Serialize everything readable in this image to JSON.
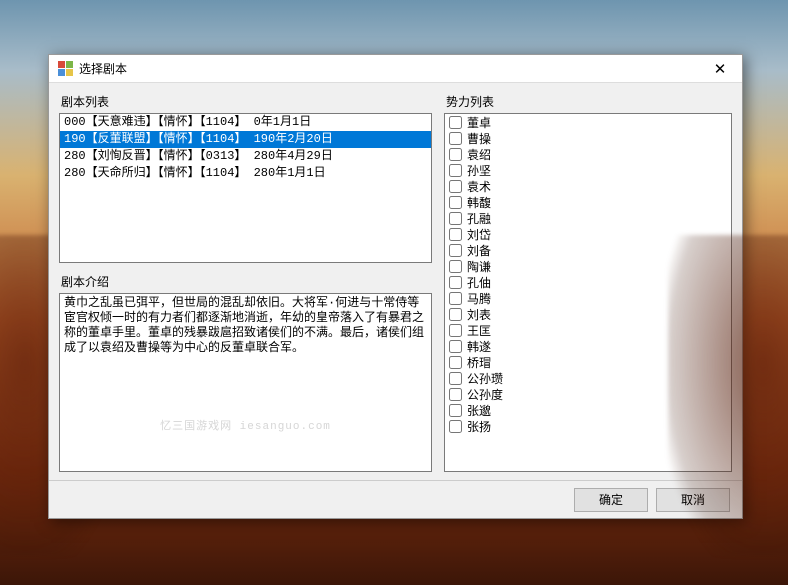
{
  "window": {
    "title": "选择剧本",
    "close_glyph": "✕"
  },
  "labels": {
    "scenario_list": "剧本列表",
    "scenario_desc": "剧本介绍",
    "faction_list": "势力列表"
  },
  "scenarios": {
    "selected_index": 1,
    "items": [
      {
        "text": "000【天意难违】【情怀】【1104】 0年1月1日"
      },
      {
        "text": "190【反董联盟】【情怀】【1104】 190年2月20日"
      },
      {
        "text": "280【刘恂反晋】【情怀】【0313】 280年4月29日"
      },
      {
        "text": "280【天命所归】【情怀】【1104】 280年1月1日"
      }
    ]
  },
  "description": "黄巾之乱虽已弭平，但世局的混乱却依旧。大将军·何进与十常侍等宦官权倾一时的有力者们都逐渐地消逝，年幼的皇帝落入了有暴君之称的董卓手里。董卓的残暴跋扈招致诸侯们的不满。最后，诸侯们组成了以袁绍及曹操等为中心的反董卓联合军。",
  "watermark": "忆三国游戏网 iesanguo.com",
  "factions": [
    "董卓",
    "曹操",
    "袁绍",
    "孙坚",
    "袁术",
    "韩馥",
    "孔融",
    "刘岱",
    "刘备",
    "陶谦",
    "孔伷",
    "马腾",
    "刘表",
    "王匡",
    "韩遂",
    "桥瑁",
    "公孙瓒",
    "公孙度",
    "张邈",
    "张扬"
  ],
  "footer": {
    "ok": "确定",
    "cancel": "取消"
  }
}
